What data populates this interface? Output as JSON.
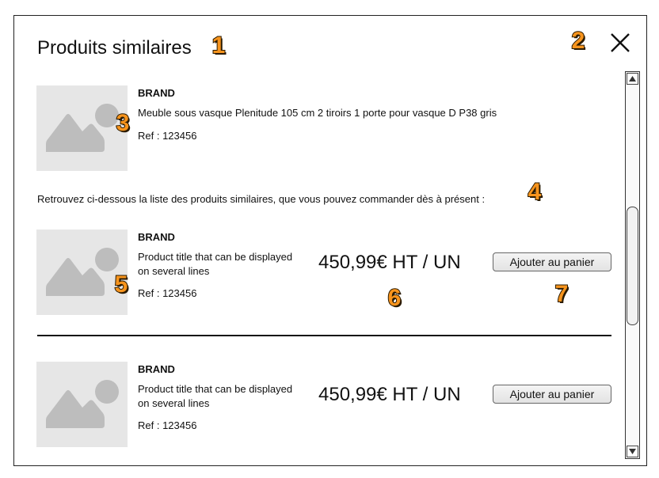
{
  "modal": {
    "title": "Produits similaires"
  },
  "reference_product": {
    "brand": "BRAND",
    "title": "Meuble sous vasque Plenitude 105 cm 2 tiroirs 1 porte pour vasque D P38 gris",
    "ref": "Ref : 123456",
    "image_icon": "image-placeholder-icon"
  },
  "intro_text": "Retrouvez ci-dessous la liste des produits similaires, que vous pouvez commander dès à présent :",
  "similar_products": [
    {
      "brand": "BRAND",
      "title_line1": "Product title that can be displayed",
      "title_line2": "on several lines",
      "ref": "Ref : 123456",
      "price": "450,99€ HT / UN",
      "cart_label": "Ajouter au panier"
    },
    {
      "brand": "BRAND",
      "title_line1": "Product title that can be displayed",
      "title_line2": "on several lines",
      "ref": "Ref : 123456",
      "price": "450,99€ HT / UN",
      "cart_label": "Ajouter au panier"
    }
  ],
  "annotations": [
    "1",
    "2",
    "3",
    "4",
    "5",
    "6",
    "7"
  ],
  "icons": {
    "close": "close-icon",
    "scroll_up": "arrow-up-icon",
    "scroll_down": "arrow-down-icon"
  },
  "colors": {
    "badge": "#f7941d",
    "placeholder_bg": "#e6e6e6",
    "placeholder_shape": "#bdbdbd"
  }
}
